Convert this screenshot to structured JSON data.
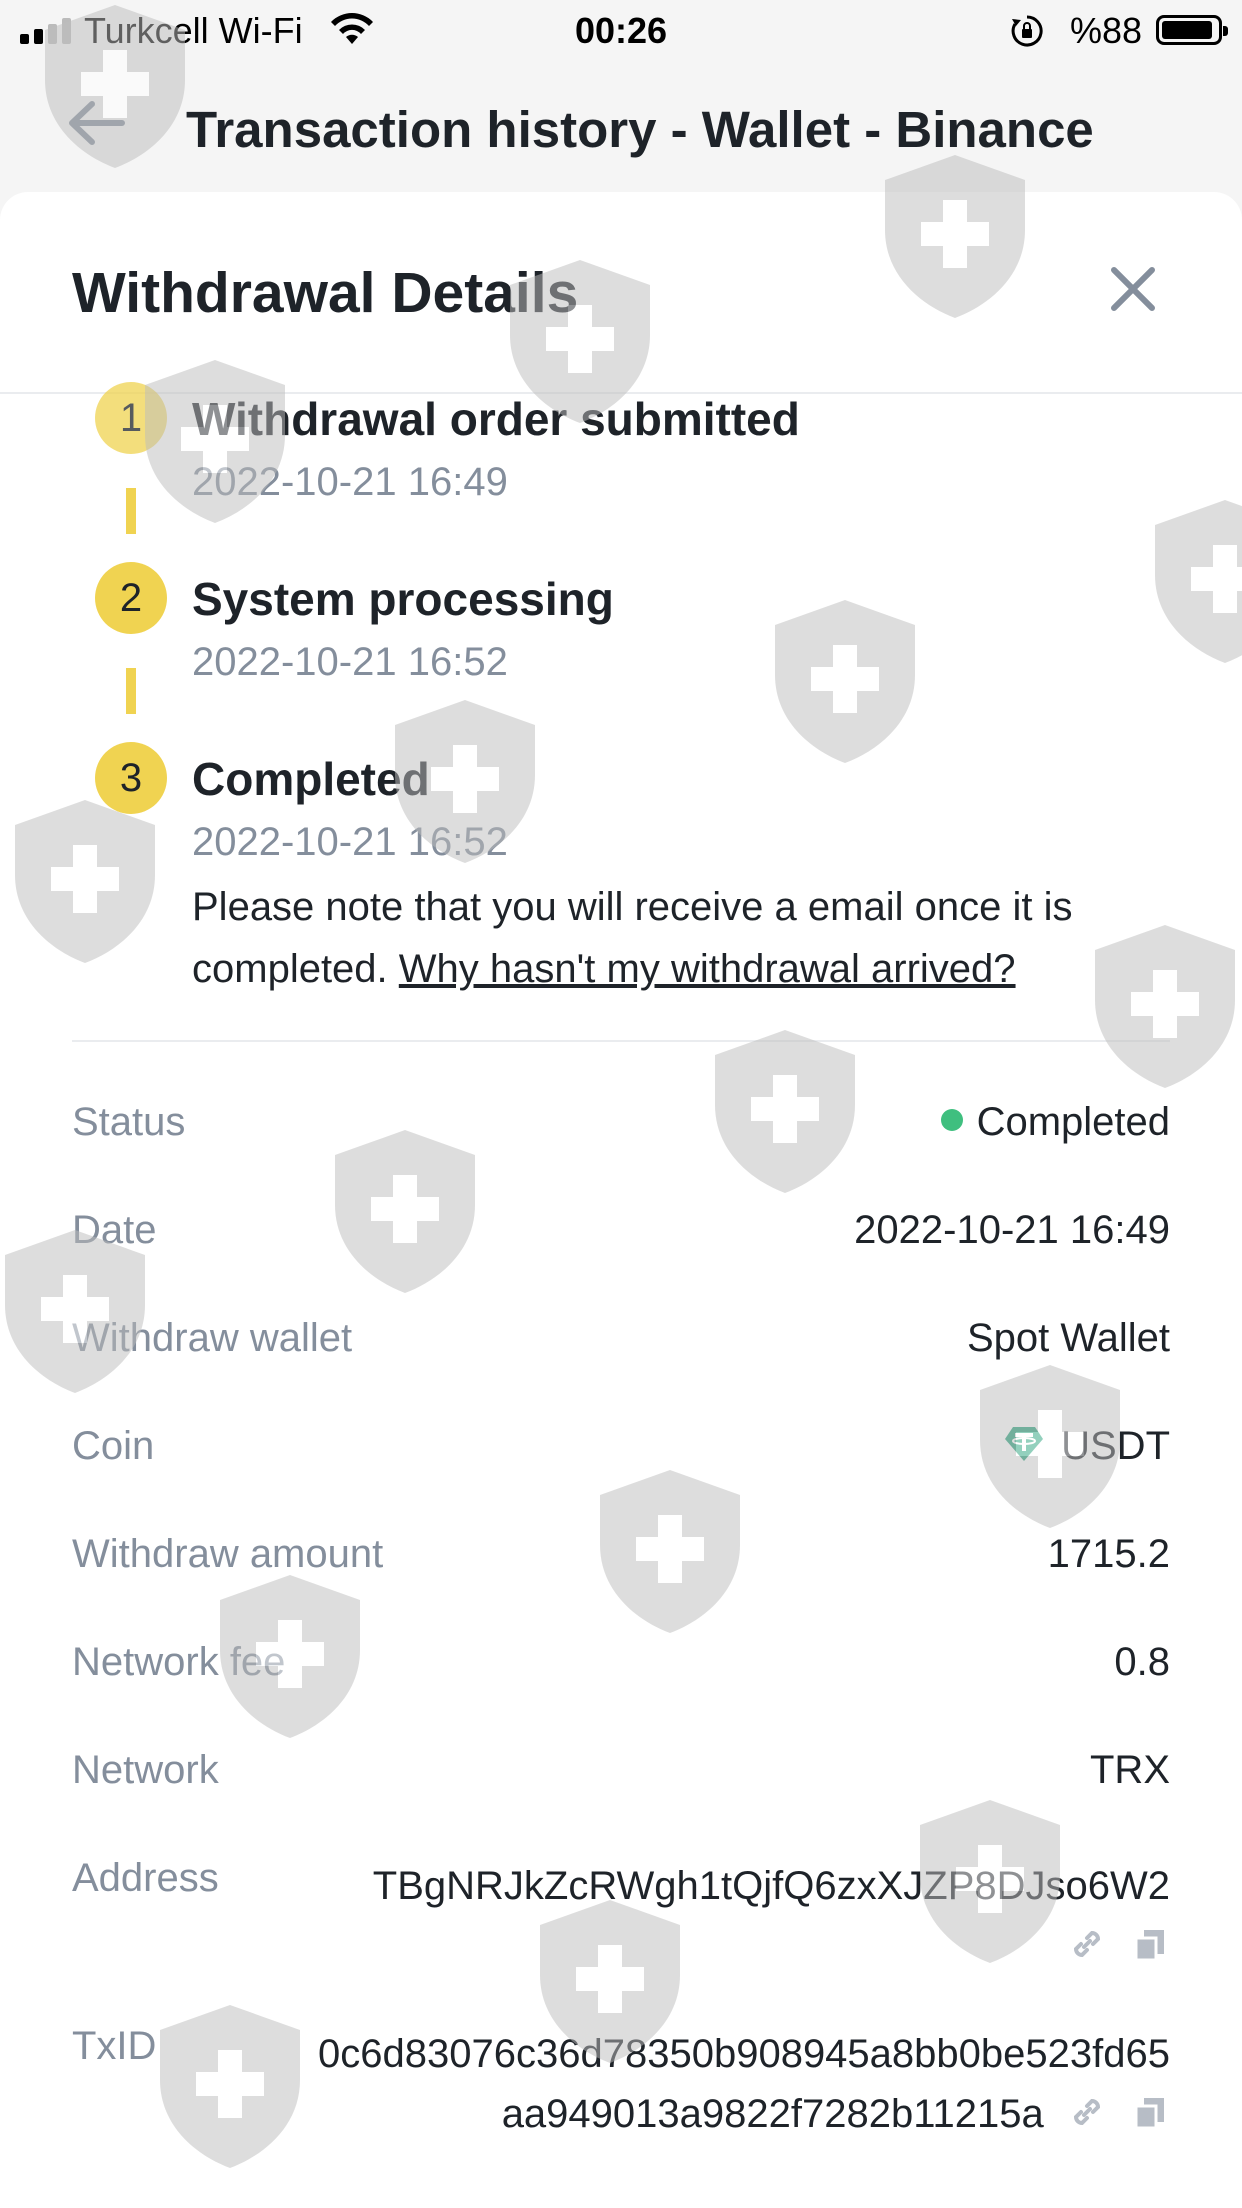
{
  "status_bar": {
    "carrier": "Turkcell Wi-Fi",
    "time": "00:26",
    "battery": "%88"
  },
  "nav": {
    "title": "Transaction history - Wallet - Binance"
  },
  "sheet": {
    "title": "Withdrawal Details",
    "steps": [
      {
        "number": "1",
        "title": "Withdrawal order submitted",
        "time": "2022-10-21 16:49"
      },
      {
        "number": "2",
        "title": "System processing",
        "time": "2022-10-21 16:52"
      },
      {
        "number": "3",
        "title": "Completed",
        "time": "2022-10-21 16:52"
      }
    ],
    "note": {
      "text": "Please note that you will receive a email once it is completed.",
      "link": "Why hasn't my withdrawal arrived?"
    },
    "details": {
      "status": {
        "label": "Status",
        "value": "Completed"
      },
      "date": {
        "label": "Date",
        "value": "2022-10-21 16:49"
      },
      "wallet": {
        "label": "Withdraw wallet",
        "value": "Spot Wallet"
      },
      "coin": {
        "label": "Coin",
        "value": "USDT"
      },
      "amount": {
        "label": "Withdraw amount",
        "value": "1715.2"
      },
      "fee": {
        "label": "Network fee",
        "value": "0.8"
      },
      "network": {
        "label": "Network",
        "value": "TRX"
      },
      "address": {
        "label": "Address",
        "value": "TBgNRJkZcRWgh1tQjfQ6zxXJZP8DJso6W2"
      },
      "txid": {
        "label": "TxID",
        "value": "0c6d83076c36d78350b908945a8bb0be523fd65aa949013a9822f7282b11215a"
      }
    }
  },
  "colors": {
    "step_yellow": "#f0d351",
    "status_green": "#3fbf7f",
    "text_primary": "#1e2329",
    "text_secondary": "#848e9c",
    "usdt_teal": "#26a17b"
  },
  "icons": [
    "back-arrow-icon",
    "close-icon",
    "link-icon",
    "copy-icon",
    "usdt-icon",
    "wifi-icon",
    "signal-icon",
    "battery-icon",
    "orientation-lock-icon"
  ]
}
